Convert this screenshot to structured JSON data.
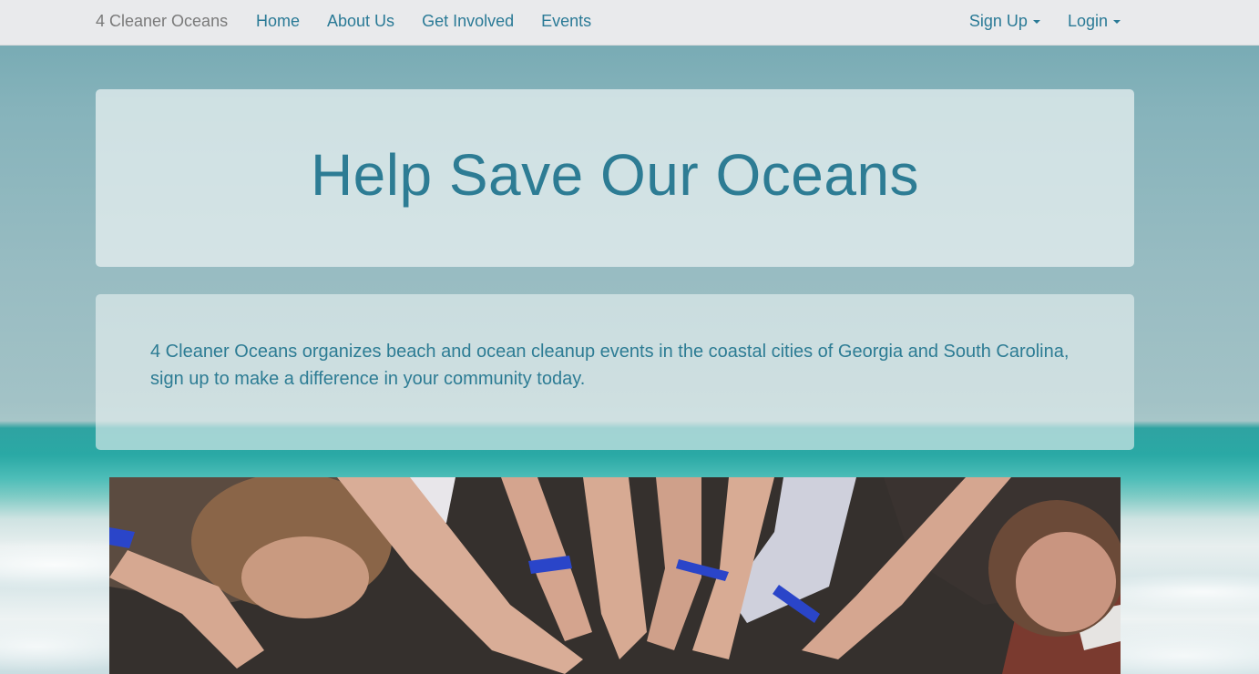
{
  "nav": {
    "brand": "4 Cleaner Oceans",
    "left_links": [
      "Home",
      "About Us",
      "Get Involved",
      "Events"
    ],
    "right_links": [
      "Sign Up",
      "Login"
    ]
  },
  "hero": {
    "title": "Help Save Our Oceans"
  },
  "intro": {
    "text": "4 Cleaner Oceans organizes beach and ocean cleanup events in the coastal cities of Georgia and South Carolina, sign up to make a difference in your community today."
  },
  "colors": {
    "accent": "#2d7c94",
    "navbar_bg": "#e9eaec"
  }
}
